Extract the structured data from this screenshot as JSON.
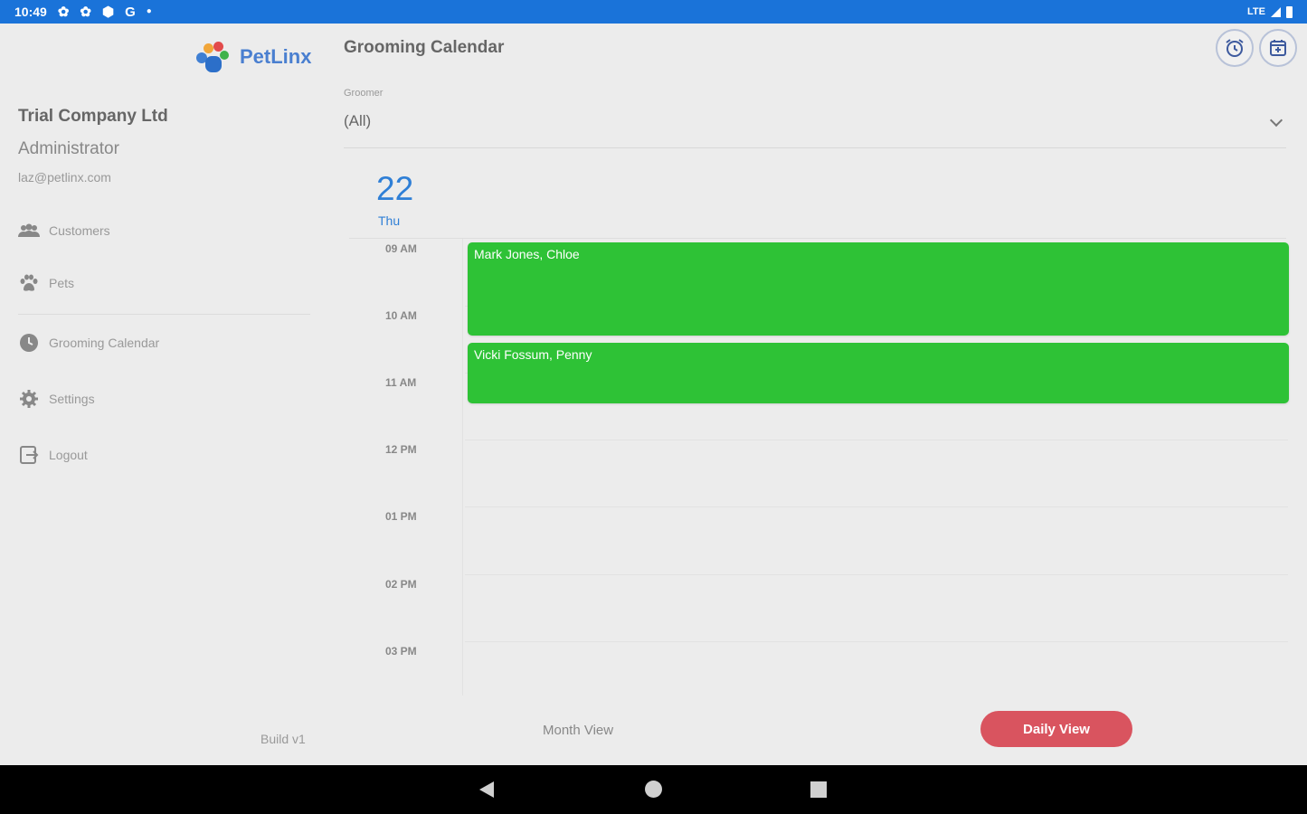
{
  "status_bar": {
    "time": "10:49",
    "left_icons": [
      "gear-icon",
      "gear-icon",
      "shield-icon",
      "google-icon",
      "dot-icon"
    ],
    "network": "LTE"
  },
  "sidebar": {
    "logo_text": "PetLinx",
    "company": "Trial Company Ltd",
    "role": "Administrator",
    "email": "laz@petlinx.com",
    "items": [
      {
        "label": "Customers",
        "icon": "people-icon"
      },
      {
        "label": "Pets",
        "icon": "paw-icon"
      },
      {
        "label": "Grooming Calendar",
        "icon": "clock-icon"
      },
      {
        "label": "Settings",
        "icon": "gear-icon"
      },
      {
        "label": "Logout",
        "icon": "logout-icon"
      }
    ],
    "build": "Build v1"
  },
  "header": {
    "title": "Grooming Calendar",
    "icons": [
      "alarm-clock-icon",
      "calendar-add-icon"
    ]
  },
  "filter": {
    "label": "Groomer",
    "value": "(All)"
  },
  "day": {
    "number": "22",
    "name": "Thu"
  },
  "timeline": {
    "hours": [
      "09 AM",
      "10 AM",
      "11 AM",
      "12 PM",
      "01 PM",
      "02 PM",
      "03 PM"
    ],
    "events": [
      {
        "title": "Mark Jones, Chloe",
        "color": "#2ec236"
      },
      {
        "title": "Vicki Fossum, Penny",
        "color": "#2ec236"
      }
    ]
  },
  "footer": {
    "month_view": "Month View",
    "daily_view": "Daily View"
  },
  "colors": {
    "status_bar": "#1a73d9",
    "accent": "#2f7fd6",
    "event": "#2ec236",
    "daily_button": "#d9545f"
  }
}
